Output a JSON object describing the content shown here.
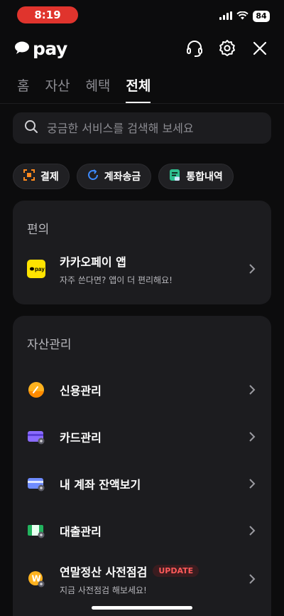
{
  "status_bar": {
    "time": "8:19",
    "battery": "84"
  },
  "header": {
    "logo_text": "pay"
  },
  "tabs": [
    {
      "label": "홈"
    },
    {
      "label": "자산"
    },
    {
      "label": "혜택"
    },
    {
      "label": "전체",
      "active": true
    }
  ],
  "search": {
    "placeholder": "궁금한 서비스를 검색해 보세요"
  },
  "chips": [
    {
      "label": "결제",
      "icon": "scan-icon"
    },
    {
      "label": "계좌송금",
      "icon": "transfer-icon"
    },
    {
      "label": "통합내역",
      "icon": "history-icon"
    }
  ],
  "convenience": {
    "title": "편의",
    "items": [
      {
        "title": "카카오페이 앱",
        "subtitle": "자주 쓴다면? 앱이 더 편리해요!",
        "icon": "kakaopay-app-icon"
      }
    ]
  },
  "assets": {
    "title": "자산관리",
    "items": [
      {
        "title": "신용관리",
        "icon": "credit-gauge-icon"
      },
      {
        "title": "카드관리",
        "icon": "card-icon"
      },
      {
        "title": "내 계좌 잔액보기",
        "icon": "account-balance-icon"
      },
      {
        "title": "대출관리",
        "icon": "loan-icon"
      },
      {
        "title": "연말정산 사전점검",
        "badge": "UPDATE",
        "subtitle": "지금 사전점검 해보세요!",
        "icon": "tax-won-icon"
      }
    ]
  },
  "colors": {
    "background": "#0c0c0d",
    "card": "#1c1c1f",
    "kakao_yellow": "#ffe300",
    "status_red": "#e0342d",
    "update_red": "#ff5a5a"
  }
}
